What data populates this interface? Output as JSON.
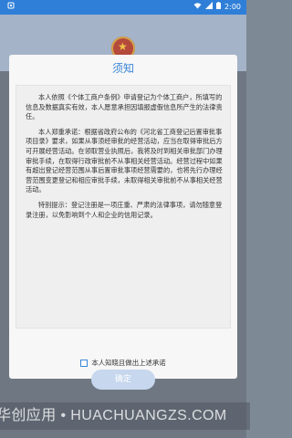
{
  "statusbar": {
    "time": "2:00",
    "left_icon": "app-notification-icon",
    "wifi_icon": "wifi-icon",
    "signal_icon": "signal-icon",
    "battery_icon": "battery-icon"
  },
  "dialog": {
    "title": "须知",
    "paragraphs": [
      "本人依照《个体工商户条例》申请登记为个体工商户，所填写的信息及数据真实有效，本人愿意承担因填报虚假信息所产生的法律责任。",
      "本人郑重承诺：根据省政府公布的《河北省工商登记后置审批事项目录》要求，如果从事须经审批的经营活动，应当在取得审批后方可开展经营活动。在领取营业执照后，我将及时到相关审批部门办理审批手续，在取得行政审批前不从事相关经营活动。经营过程中如果有超出登记经营范围从事后置审批事项经营需要的，也将先行办理经营范围变更登记和相应审批手续，未取得相关审批前不从事相关经营活动。",
      "特别提示：登记注册是一项庄重、严肃的法律事项，请勿随意登录注册，以免影响到个人和企业的信用记录。"
    ],
    "agree_label": "本人知晓且做出上述承诺",
    "confirm_label": "确定"
  },
  "watermark": "华创应用 • HUACHUANGZS.COM",
  "colors": {
    "statusbar": "#2f7fd8",
    "title": "#3b86d6",
    "button_disabled": "#c6d7ee"
  }
}
